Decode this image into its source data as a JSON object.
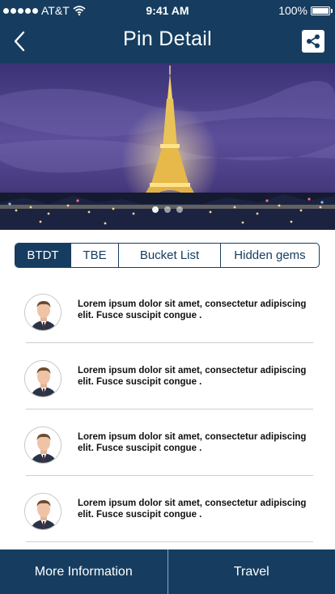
{
  "status_bar": {
    "carrier": "AT&T",
    "time": "9:41 AM",
    "battery": "100%"
  },
  "header": {
    "title": "Pin Detail",
    "back_icon": "chevron-left-icon",
    "share_icon": "share-icon"
  },
  "hero": {
    "pager": {
      "count": 3,
      "active": 0
    }
  },
  "tabs": [
    {
      "label": "BTDT",
      "active": true
    },
    {
      "label": "TBE",
      "active": false
    },
    {
      "label": "Bucket List",
      "active": false
    },
    {
      "label": "Hidden gems",
      "active": false
    }
  ],
  "list": {
    "items": [
      {
        "line1": "Lorem ipsum dolor sit amet, consectetur adipiscing",
        "line2": "elit. Fusce suscipit congue ."
      },
      {
        "line1": "Lorem ipsum dolor sit amet, consectetur adipiscing",
        "line2": "elit. Fusce suscipit congue ."
      },
      {
        "line1": "Lorem ipsum dolor sit amet, consectetur adipiscing",
        "line2": "elit. Fusce suscipit congue ."
      },
      {
        "line1": "Lorem ipsum dolor sit amet, consectetur adipiscing",
        "line2": "elit. Fusce suscipit congue ."
      }
    ]
  },
  "bottom_bar": {
    "more_info_label": "More Information",
    "travel_label": "Travel"
  },
  "colors": {
    "primary": "#163d60",
    "divider": "#cfcfcf"
  }
}
